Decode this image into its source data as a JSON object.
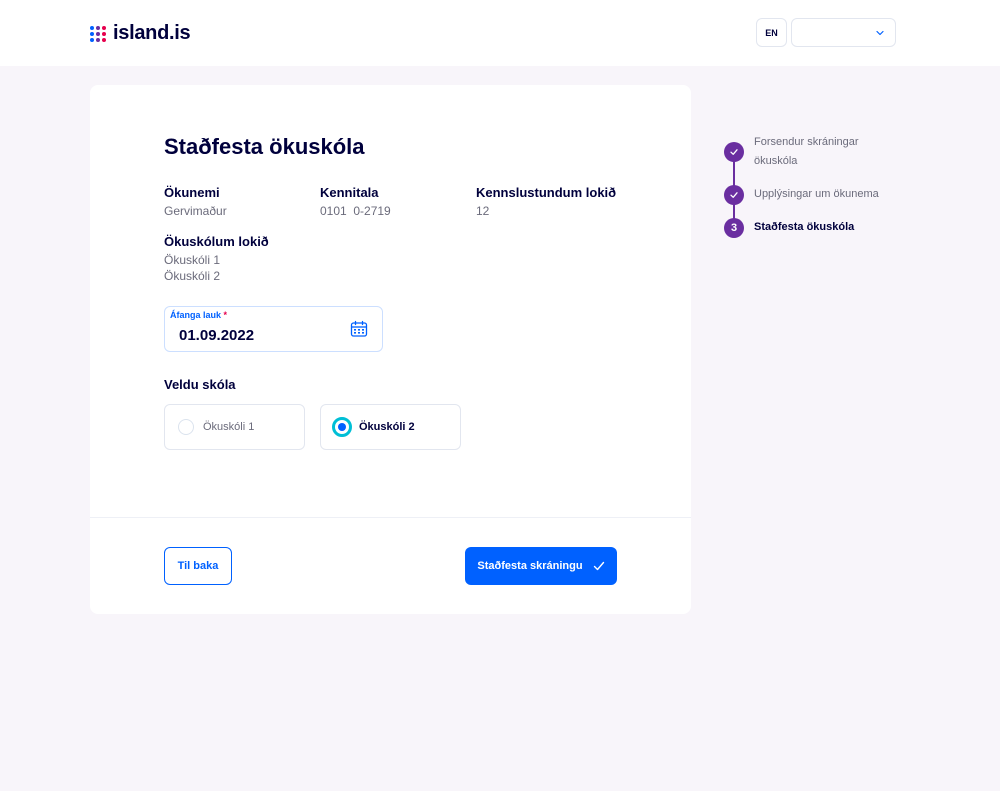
{
  "header": {
    "logo_text": "island.is",
    "lang_button": "EN",
    "user_select_value": ""
  },
  "form": {
    "title": "Staðfesta ökuskóla",
    "fields": [
      {
        "label": "Ökunemi",
        "values": [
          "Gervimaður"
        ]
      },
      {
        "label": "Kennitala",
        "values": [
          "0101  0-2719"
        ]
      },
      {
        "label": "Kennslustundum lokið",
        "values": [
          "12"
        ]
      },
      {
        "label": "Ökuskólum lokið",
        "values": [
          "Ökuskóli 1",
          "Ökuskóli 2"
        ]
      }
    ],
    "date_field": {
      "label": "Áfanga lauk",
      "required_mark": "*",
      "value": "01.09.2022"
    },
    "school_select": {
      "title": "Veldu skóla",
      "options": [
        {
          "label": "Ökuskóli 1",
          "selected": false
        },
        {
          "label": "Ökuskóli 2",
          "selected": true
        }
      ]
    },
    "back_button": "Til baka",
    "confirm_button": "Staðfesta skráningu"
  },
  "stepper": {
    "steps": [
      {
        "label": "Forsendur skráningar ökuskóla",
        "status": "done",
        "icon": "check-icon"
      },
      {
        "label": "Upplýsingar um ökunema",
        "status": "done",
        "icon": "check-icon"
      },
      {
        "label": "Staðfesta ökuskóla",
        "status": "current",
        "number": "3"
      }
    ]
  },
  "colors": {
    "primary": "#0061ff",
    "step_purple": "#6a2ea0",
    "radio_ring": "#00bfd6",
    "text_dark": "#00003c",
    "background": "#f8f5fa"
  }
}
